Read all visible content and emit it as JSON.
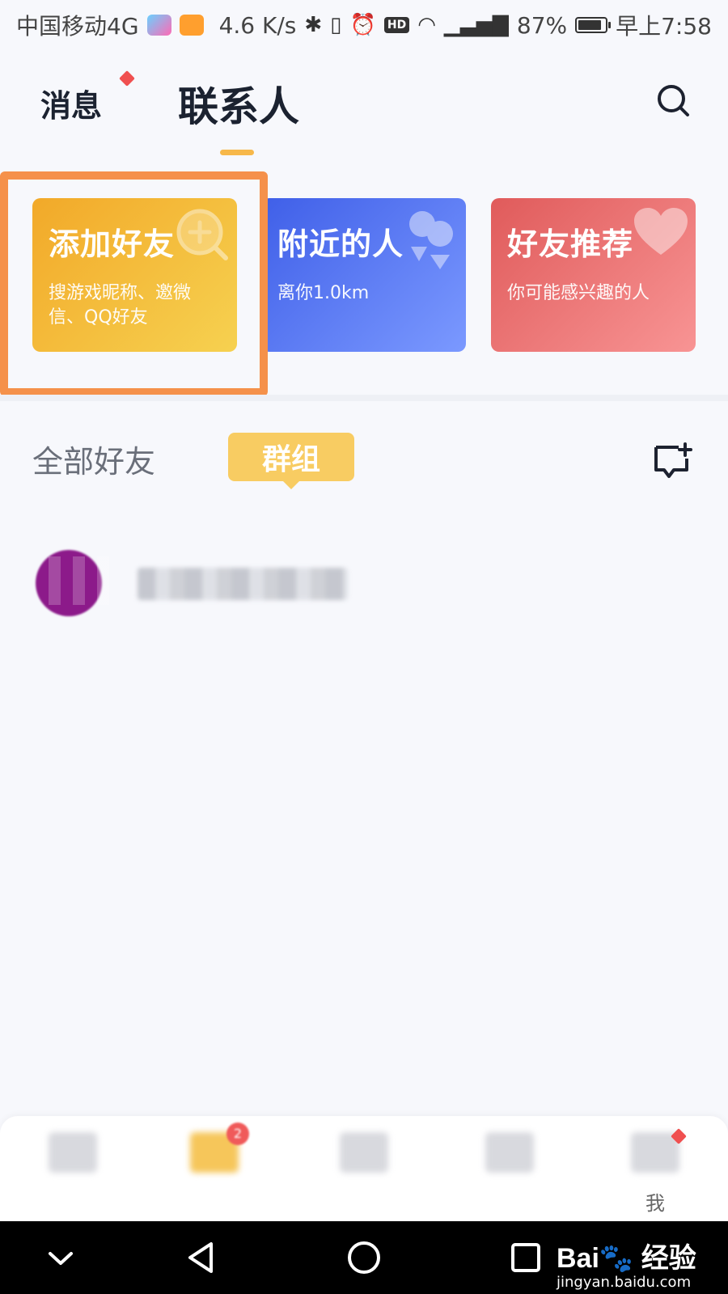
{
  "status_bar": {
    "carrier": "中国移动4G",
    "speed": "4.6 K/s",
    "network": "4G",
    "battery": "87%",
    "battery_level": 0.87,
    "time": "早上7:58"
  },
  "header": {
    "tab_messages": "消息",
    "tab_contacts": "联系人"
  },
  "cards": [
    {
      "title": "添加好友",
      "subtitle": "搜游戏昵称、邀微信、QQ好友"
    },
    {
      "title": "附近的人",
      "subtitle": "离你1.0km"
    },
    {
      "title": "好友推荐",
      "subtitle": "你可能感兴趣的人"
    }
  ],
  "section": {
    "all_friends": "全部好友",
    "groups": "群组"
  },
  "bottom_nav": {
    "items": [
      {
        "label": "",
        "icon": "blurred-icon"
      },
      {
        "label": "",
        "icon": "blurred-icon",
        "badge": "2"
      },
      {
        "label": "",
        "icon": "blurred-icon"
      },
      {
        "label": "",
        "icon": "blurred-icon"
      },
      {
        "label": "我",
        "icon": "profile-icon"
      }
    ]
  },
  "watermark": {
    "logo": "Bai 经验",
    "url": "jingyan.baidu.com"
  },
  "colors": {
    "accent": "#f7b84a",
    "highlight_border": "#f5914a",
    "card_add": "#f2a929",
    "card_nearby": "#4f6ef0",
    "card_recommend": "#e86a6a",
    "badge_red": "#f05050"
  }
}
